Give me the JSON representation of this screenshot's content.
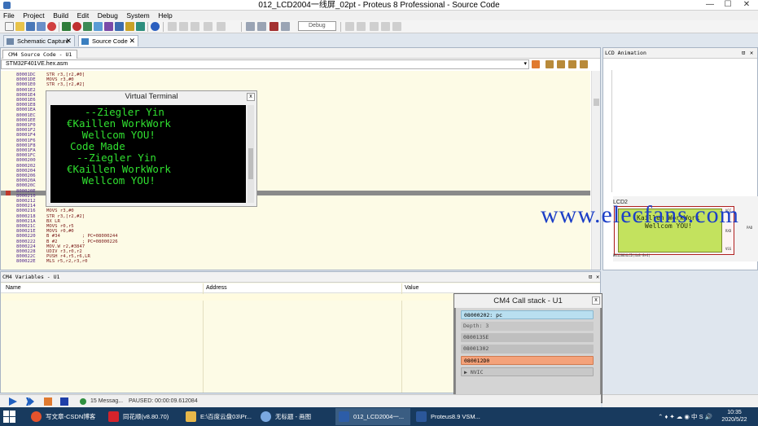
{
  "window": {
    "title": "012_LCD2004一线屏_02pt - Proteus 8 Professional - Source Code",
    "minimize": "—",
    "maximize": "☐",
    "close": "✕"
  },
  "menu": [
    "File",
    "Project",
    "Build",
    "Edit",
    "Debug",
    "System",
    "Help"
  ],
  "toolbar": {
    "config_select": "Debug"
  },
  "doc_tabs": [
    {
      "label": "Schematic Capture",
      "close": "✕"
    },
    {
      "label": "Source Code",
      "close": "✕"
    }
  ],
  "source": {
    "tab": "CM4 Source Code - U1",
    "file": "STM32F401VE.hex.asm",
    "lines": [
      {
        "addr": "80001DC",
        "instr": "STR r3,[r2,#0]"
      },
      {
        "addr": "80001DE",
        "instr": "MOVS r3,#0"
      },
      {
        "addr": "80001E0",
        "instr": "STR r3,[r2,#2]"
      },
      {
        "addr": "80001E2",
        "instr": ""
      },
      {
        "addr": "80001E4",
        "instr": "M"
      },
      {
        "addr": "80001E6",
        "instr": "M"
      },
      {
        "addr": "80001E8",
        "instr": ""
      },
      {
        "addr": "80001EA",
        "instr": ""
      },
      {
        "addr": "80001EC",
        "instr": ""
      },
      {
        "addr": "80001EE",
        "instr": ""
      },
      {
        "addr": "80001F0",
        "instr": ""
      },
      {
        "addr": "80001F2",
        "instr": ""
      },
      {
        "addr": "80001F4",
        "instr": ""
      },
      {
        "addr": "80001F6",
        "instr": ""
      },
      {
        "addr": "80001F8",
        "instr": ""
      },
      {
        "addr": "80001FA",
        "instr": ""
      },
      {
        "addr": "80001FC",
        "instr": ""
      },
      {
        "addr": "8000200",
        "instr": ""
      },
      {
        "addr": "8000202",
        "instr": ""
      },
      {
        "addr": "8000204",
        "instr": ""
      },
      {
        "addr": "8000206",
        "instr": ""
      },
      {
        "addr": "800020A",
        "instr": ""
      },
      {
        "addr": "800020C",
        "instr": ""
      },
      {
        "addr": "800020E",
        "instr": ""
      },
      {
        "addr": "8000210",
        "instr": ""
      },
      {
        "addr": "8000212",
        "instr": ""
      },
      {
        "addr": "8000214",
        "instr": ""
      },
      {
        "addr": "8000216",
        "instr": "MOVS r3,#0"
      },
      {
        "addr": "8000218",
        "instr": "STR r3,[r2,#2]"
      },
      {
        "addr": "800021A",
        "instr": "BX LR"
      },
      {
        "addr": "800021C",
        "instr": "MOVS r0,r5"
      },
      {
        "addr": "800021E",
        "instr": "MOVS r0,#0"
      },
      {
        "addr": "8000220",
        "instr": "B #34        ; PC=08000244"
      },
      {
        "addr": "8000222",
        "instr": "B #2         ; PC=08000226"
      },
      {
        "addr": "8000224",
        "instr": "MOV.W r2,#3847"
      },
      {
        "addr": "8000228",
        "instr": "UDIV r3,r0,r2"
      },
      {
        "addr": "800022C",
        "instr": "PUSH r4,r5,r6,LR"
      },
      {
        "addr": "800022E",
        "instr": "MLS r5,r2,r3,r0"
      }
    ]
  },
  "terminal": {
    "title": "Virtual Terminal",
    "close": "x",
    "lines": [
      "  --Ziegler Yin",
      "€Kaillen WorkWork",
      "   Wellcom YOU!",
      "Code Made",
      "  --Ziegler Yin",
      "€Kaillen WorkWork",
      "   Wellcom YOU!"
    ]
  },
  "lcd": {
    "panel_title": "LCD Animation",
    "pin": "⊡",
    "close": "✕",
    "component": "LCD2",
    "line1": "Kaillen WorkWork",
    "line2": "Wellcom YOU!",
    "part": "WG12864LCD(4x8-8+4)",
    "pins": [
      "VCC",
      "RXD",
      "VSS",
      "PAD"
    ]
  },
  "watermark": "www.elecfans.com",
  "variables": {
    "title": "CM4 Variables - U1",
    "pin": "⊡",
    "close": "✕",
    "columns": [
      "Name",
      "Address",
      "Value"
    ]
  },
  "callstack": {
    "title": "CM4 Call stack - U1",
    "close": "x",
    "rows": [
      {
        "text": "08000202: pc",
        "style": "current"
      },
      {
        "text": "Depth: 3",
        "style": "info"
      },
      {
        "text": "0800135E",
        "style": "frame"
      },
      {
        "text": "08001302",
        "style": "frame"
      },
      {
        "text": "080012D0",
        "style": "selected"
      },
      {
        "text": "▶ NVIC",
        "style": "group"
      }
    ]
  },
  "debugbar": {
    "messages": "15 Messag...",
    "status": "PAUSED: 00:00:09.612084"
  },
  "taskbar": {
    "items": [
      {
        "label": "写文章-CSDN博客",
        "color": "#e5532d"
      },
      {
        "label": "同花顺(v8.80.70)",
        "color": "#d4232b"
      },
      {
        "label": "E:\\百度云盘03\\Pr...",
        "color": "#e8b84a"
      },
      {
        "label": "无标题 - 画图",
        "color": "#7aa8e0"
      },
      {
        "label": "012_LCD2004一...",
        "color": "#2d5da8"
      },
      {
        "label": "Proteus8.9 VSM...",
        "color": "#2b579a"
      }
    ],
    "tray": "⌃ ♦ ✦ ☁ ◉ 中 S 🔊",
    "time": "10:35",
    "date": "2020/5/22"
  },
  "colors": {
    "code_bg": "#fdfbe6",
    "terminal_text": "#30e030",
    "lcd_green": "#c3e25e",
    "callstack_current": "#b9dff0",
    "callstack_selected": "#f4a27a",
    "watermark": "#1c3fc7"
  }
}
